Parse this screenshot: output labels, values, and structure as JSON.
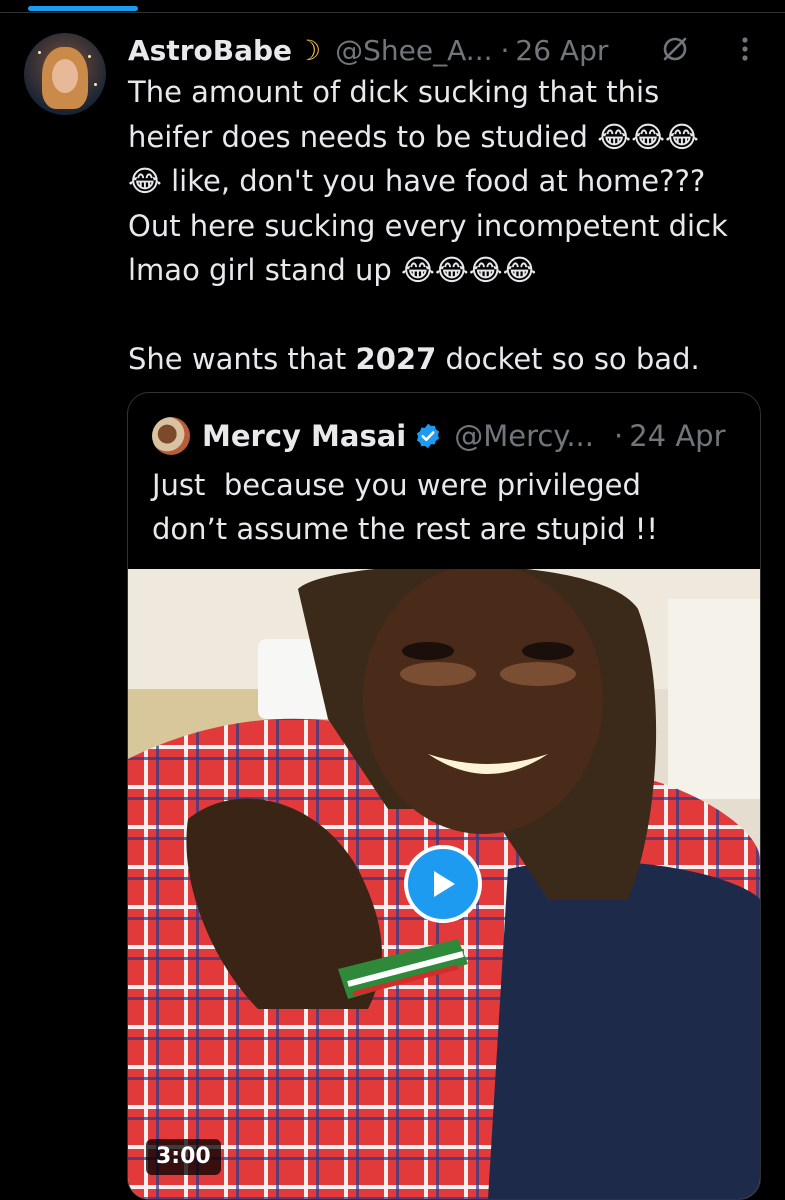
{
  "tweet": {
    "display_name": "AstroBabe",
    "name_emoji": "☽",
    "handle": "@Shee_A...",
    "separator": "·",
    "date": "26 Apr",
    "line1": "The amount of dick sucking that this",
    "line2a": "heifer does needs to be studied ",
    "laugh": "😂",
    "line3": " like, don't you have food at home???",
    "line4": "Out here sucking every incompetent dick",
    "line5": "lmao girl stand up ",
    "line7a": "She wants that ",
    "line7b": "2027",
    "line7c": " docket so so bad."
  },
  "quote": {
    "display_name": "Mercy Masai",
    "handle": "@Mercy...",
    "separator": "·",
    "date": "24 Apr",
    "text": "Just  because you were privileged\ndon’t assume the rest are stupid !!",
    "video_duration": "3:00"
  },
  "colors": {
    "accent": "#1d9bf0",
    "secondary_text": "#71767b",
    "border": "#2f3336"
  },
  "icons": [
    "muted-icon",
    "more-options-icon",
    "verified-badge-icon",
    "play-icon"
  ]
}
